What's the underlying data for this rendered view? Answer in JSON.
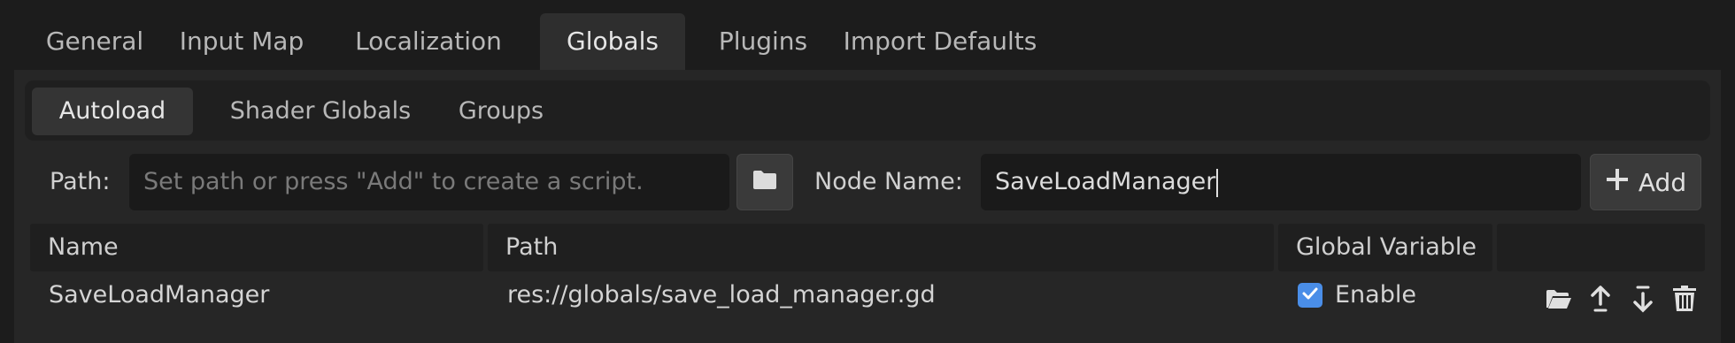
{
  "tabs": [
    "General",
    "Input Map",
    "Localization",
    "Globals",
    "Plugins",
    "Import Defaults"
  ],
  "active_tab": "Globals",
  "subtabs": [
    "Autoload",
    "Shader Globals",
    "Groups"
  ],
  "active_subtab": "Autoload",
  "form": {
    "path_label": "Path:",
    "path_placeholder": "Set path or press \"Add\" to create a script.",
    "path_value": "",
    "node_name_label": "Node Name:",
    "node_name_value": "SaveLoadManager",
    "add_label": "Add"
  },
  "table": {
    "columns": [
      "Name",
      "Path",
      "Global Variable",
      ""
    ],
    "rows": [
      {
        "name": "SaveLoadManager",
        "path": "res://globals/save_load_manager.gd",
        "global_checked": true,
        "global_label": "Enable"
      }
    ]
  },
  "icons": {
    "browse": "folder-icon",
    "add": "plus-icon",
    "row_actions": [
      "open-folder-icon",
      "move-up-icon",
      "move-down-icon",
      "delete-icon"
    ]
  },
  "colors": {
    "checkbox": "#4a8ee8",
    "background": "#1c1c1c",
    "panel": "#262626"
  }
}
